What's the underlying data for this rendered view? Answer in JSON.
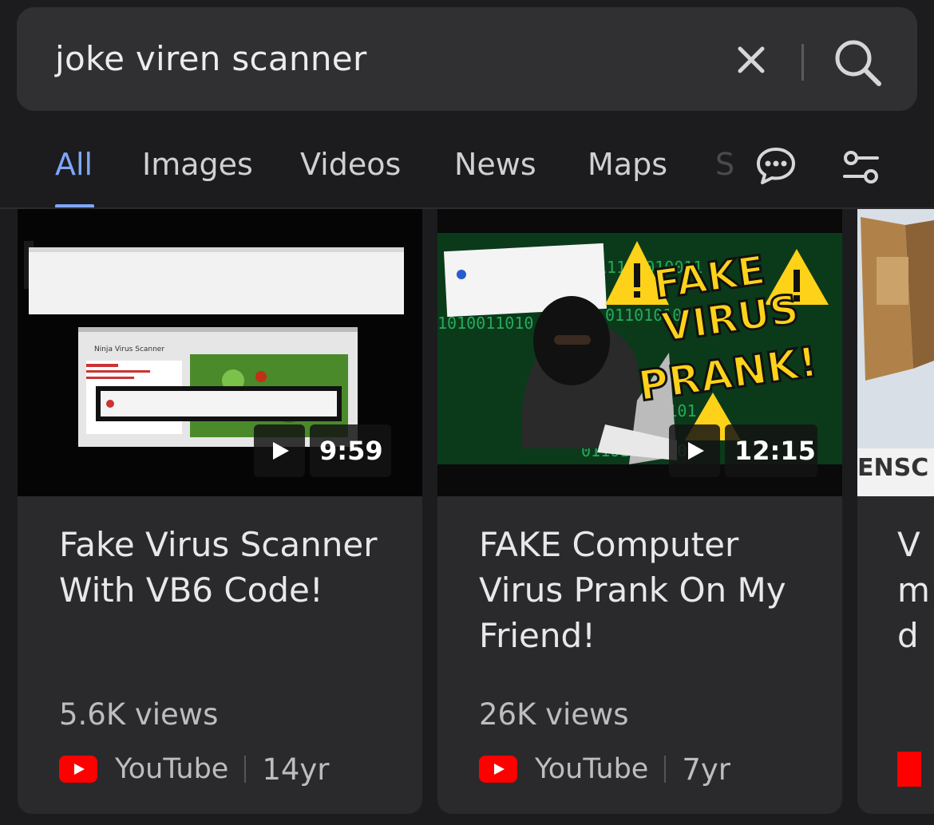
{
  "search": {
    "query": "joke viren scanner"
  },
  "tabs": [
    {
      "label": "All"
    },
    {
      "label": "Images"
    },
    {
      "label": "Videos"
    },
    {
      "label": "News"
    },
    {
      "label": "Maps"
    },
    {
      "label": "S"
    }
  ],
  "thumb_text": {
    "card1_window": "Ninja Virus Scanner",
    "card2_fake": "FAKE",
    "card2_virus": "VIRUS",
    "card2_prank": "PRANK!",
    "card3_text": "ENSC"
  },
  "videos": [
    {
      "title": "Fake Virus Scanner With VB6 Code!",
      "duration": "9:59",
      "views": "5.6K views",
      "source": "YouTube",
      "age": "14yr"
    },
    {
      "title": "FAKE Computer Virus Prank On My Friend!",
      "duration": "12:15",
      "views": "26K views",
      "source": "YouTube",
      "age": "7yr"
    },
    {
      "title_lines": [
        "V",
        "m",
        "d"
      ]
    }
  ],
  "colors": {
    "accent": "#7fa7ff",
    "youtube_red": "#ff0000"
  }
}
